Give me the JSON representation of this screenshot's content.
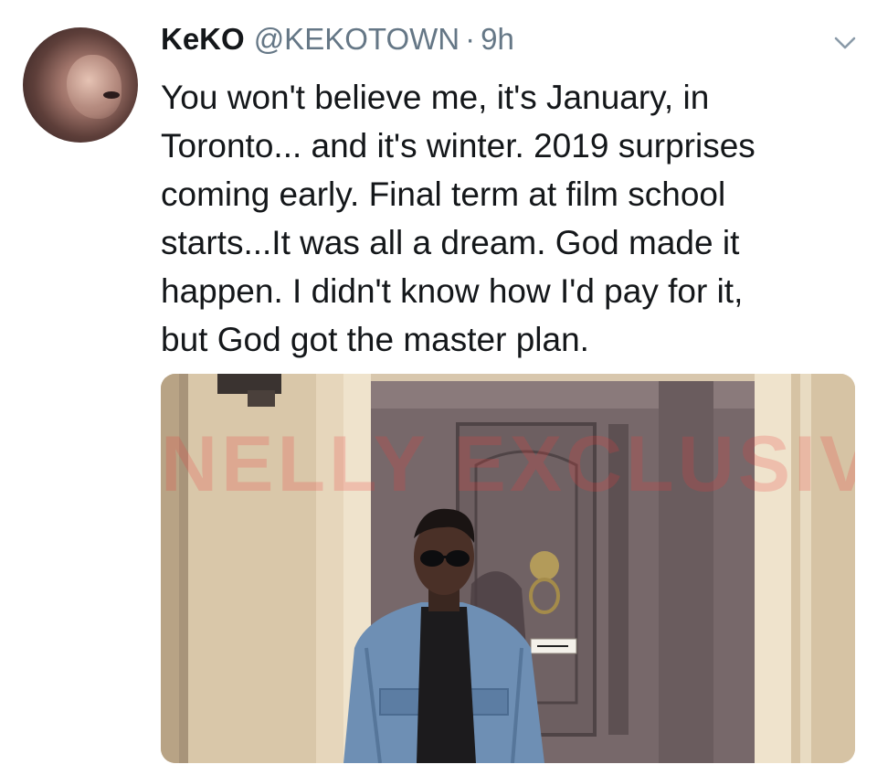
{
  "tweet": {
    "display_name": "KeKO",
    "handle": "@KEKOTOWN",
    "separator": "·",
    "time": "9h",
    "text": "You won't believe me, it's January, in\nToronto... and it's winter. 2019 surprises\ncoming early. Final term at film school\nstarts...It was all a dream. God made it\nhappen. I didn't know how I'd pay for it,\nbut God got the master plan.",
    "media": {
      "watermark": "NELLY EXCLUSIVE"
    }
  },
  "icons": {
    "avatar": "avatar",
    "more": "chevron-down-icon"
  },
  "colors": {
    "text": "#14171a",
    "secondary": "#657786",
    "watermark": "#eb3c3c"
  }
}
